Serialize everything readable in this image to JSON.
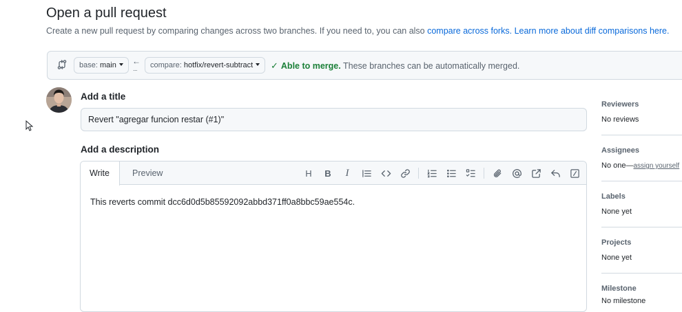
{
  "header": {
    "title": "Open a pull request",
    "subtitle_text": "Create a new pull request by comparing changes across two branches. If you need to, you can also ",
    "compare_forks_link": "compare across forks.",
    "learn_more_link": "Learn more about diff comparisons here."
  },
  "branches": {
    "base_prefix": "base:",
    "base_value": "main",
    "arrow": "←",
    "arrow_dots": "...",
    "compare_prefix": "compare:",
    "compare_value": "hotfix/revert-subtract",
    "merge_status": "Able to merge.",
    "merge_detail": "These branches can be automatically merged."
  },
  "form": {
    "title_label": "Add a title",
    "title_value": "Revert \"agregar funcion restar (#1)\"",
    "description_label": "Add a description",
    "tabs": [
      {
        "label": "Write"
      },
      {
        "label": "Preview"
      }
    ],
    "description_value": "This reverts commit dcc6d0d5b85592092abbd371ff0a8bbc59ae554c."
  },
  "sidebar": {
    "reviewers": {
      "label": "Reviewers",
      "value": "No reviews"
    },
    "assignees": {
      "label": "Assignees",
      "value": "No one—",
      "link": "assign yourself"
    },
    "labels": {
      "label": "Labels",
      "value": "None yet"
    },
    "projects": {
      "label": "Projects",
      "value": "None yet"
    },
    "milestone": {
      "label": "Milestone",
      "value": "No milestone"
    }
  },
  "colors": {
    "link": "#0969da",
    "success": "#1a7f37",
    "muted": "#59636e",
    "border": "#d1d9e0"
  }
}
